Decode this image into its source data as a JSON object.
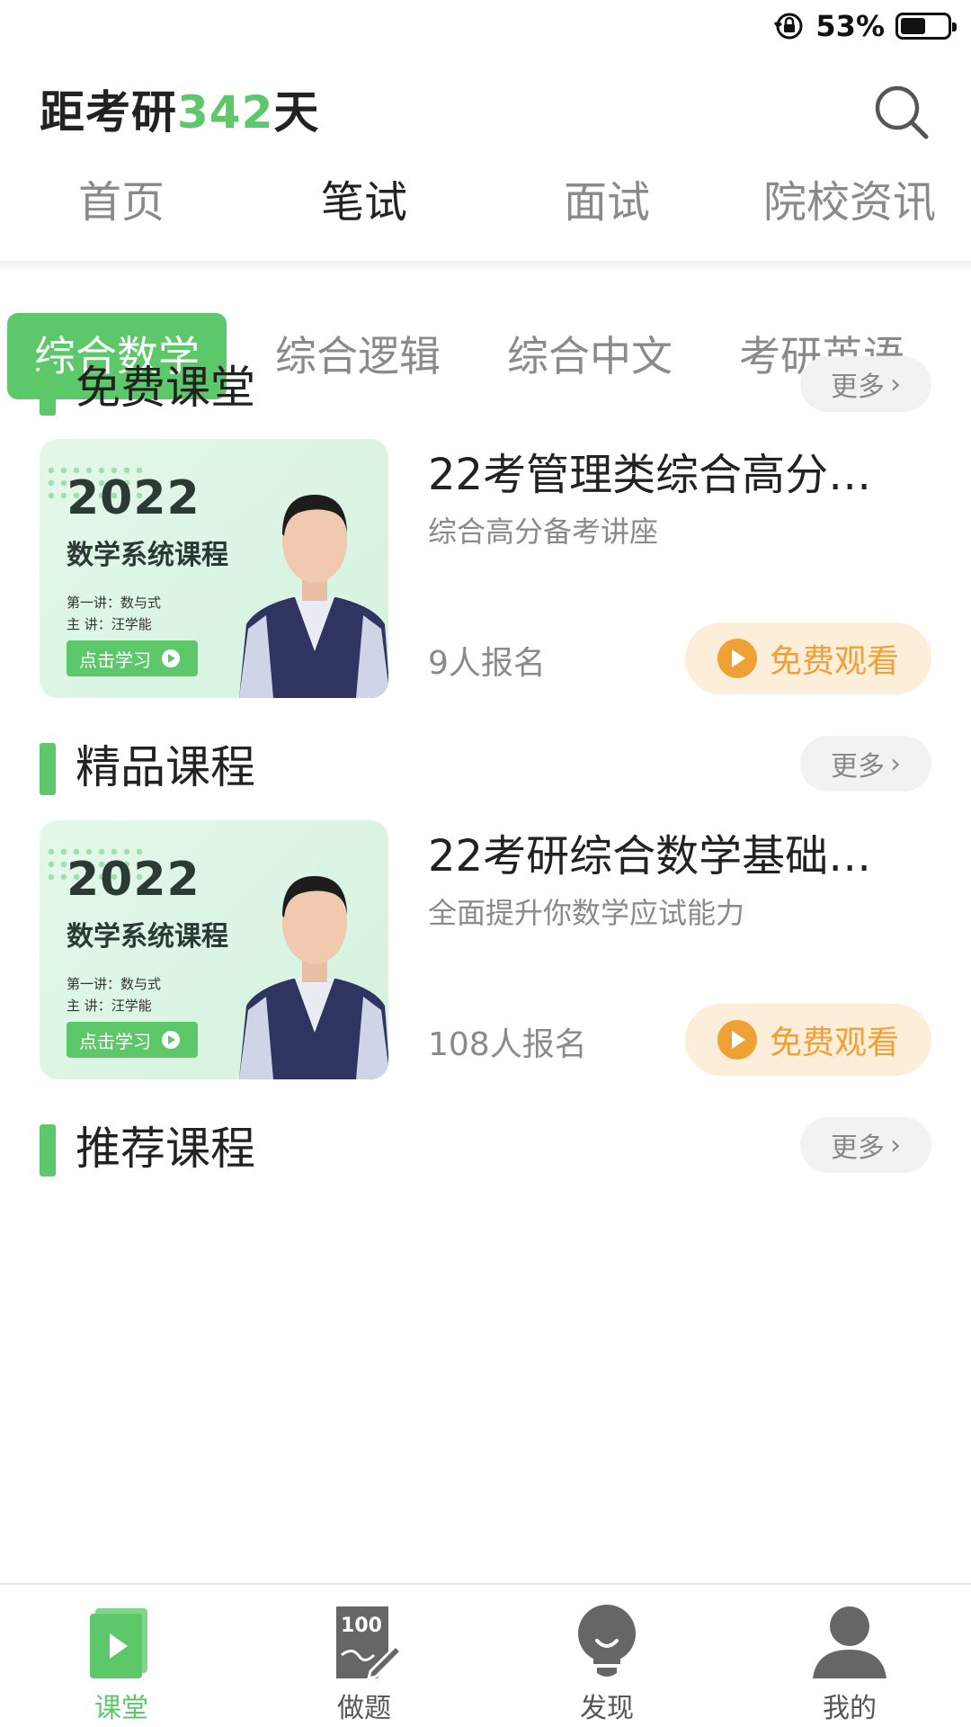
{
  "status": {
    "battery_percent": "53%",
    "battery_level": 0.53
  },
  "header": {
    "countdown_prefix": "距考研",
    "countdown_days": "342",
    "countdown_suffix": "天"
  },
  "top_tabs": [
    {
      "label": "首页",
      "active": false
    },
    {
      "label": "笔试",
      "active": true
    },
    {
      "label": "面试",
      "active": false
    },
    {
      "label": "院校资讯",
      "active": false
    }
  ],
  "subjects": [
    {
      "label": "综合数学",
      "active": true
    },
    {
      "label": "综合逻辑",
      "active": false
    },
    {
      "label": "综合中文",
      "active": false
    },
    {
      "label": "考研英语",
      "active": false
    }
  ],
  "sections": {
    "free": {
      "title": "免费课堂",
      "more": "更多",
      "course": {
        "title": "22考管理类综合高分…",
        "subtitle": "综合高分备考讲座",
        "enrolled": "9人报名",
        "action": "免费观看",
        "thumb": {
          "year": "2022",
          "name": "数学系统课程",
          "lecture": "第一讲：数与式",
          "teacher": "主  讲：汪学能",
          "button": "点击学习"
        }
      }
    },
    "premium": {
      "title": "精品课程",
      "more": "更多",
      "course": {
        "title": "22考研综合数学基础…",
        "subtitle": "全面提升你数学应试能力",
        "enrolled": "108人报名",
        "action": "免费观看",
        "thumb": {
          "year": "2022",
          "name": "数学系统课程",
          "lecture": "第一讲：数与式",
          "teacher": "主  讲：汪学能",
          "button": "点击学习"
        }
      }
    },
    "recommended": {
      "title": "推荐课程",
      "more": "更多"
    }
  },
  "bottom_nav": [
    {
      "label": "课堂",
      "icon": "classroom-icon",
      "active": true
    },
    {
      "label": "做题",
      "icon": "exercise-icon",
      "badge": "100",
      "active": false
    },
    {
      "label": "发现",
      "icon": "lightbulb-icon",
      "active": false
    },
    {
      "label": "我的",
      "icon": "user-icon",
      "active": false
    }
  ],
  "colors": {
    "accent": "#5cc86a",
    "orange": "#f0a135",
    "orange_bg": "#fdeed9"
  }
}
